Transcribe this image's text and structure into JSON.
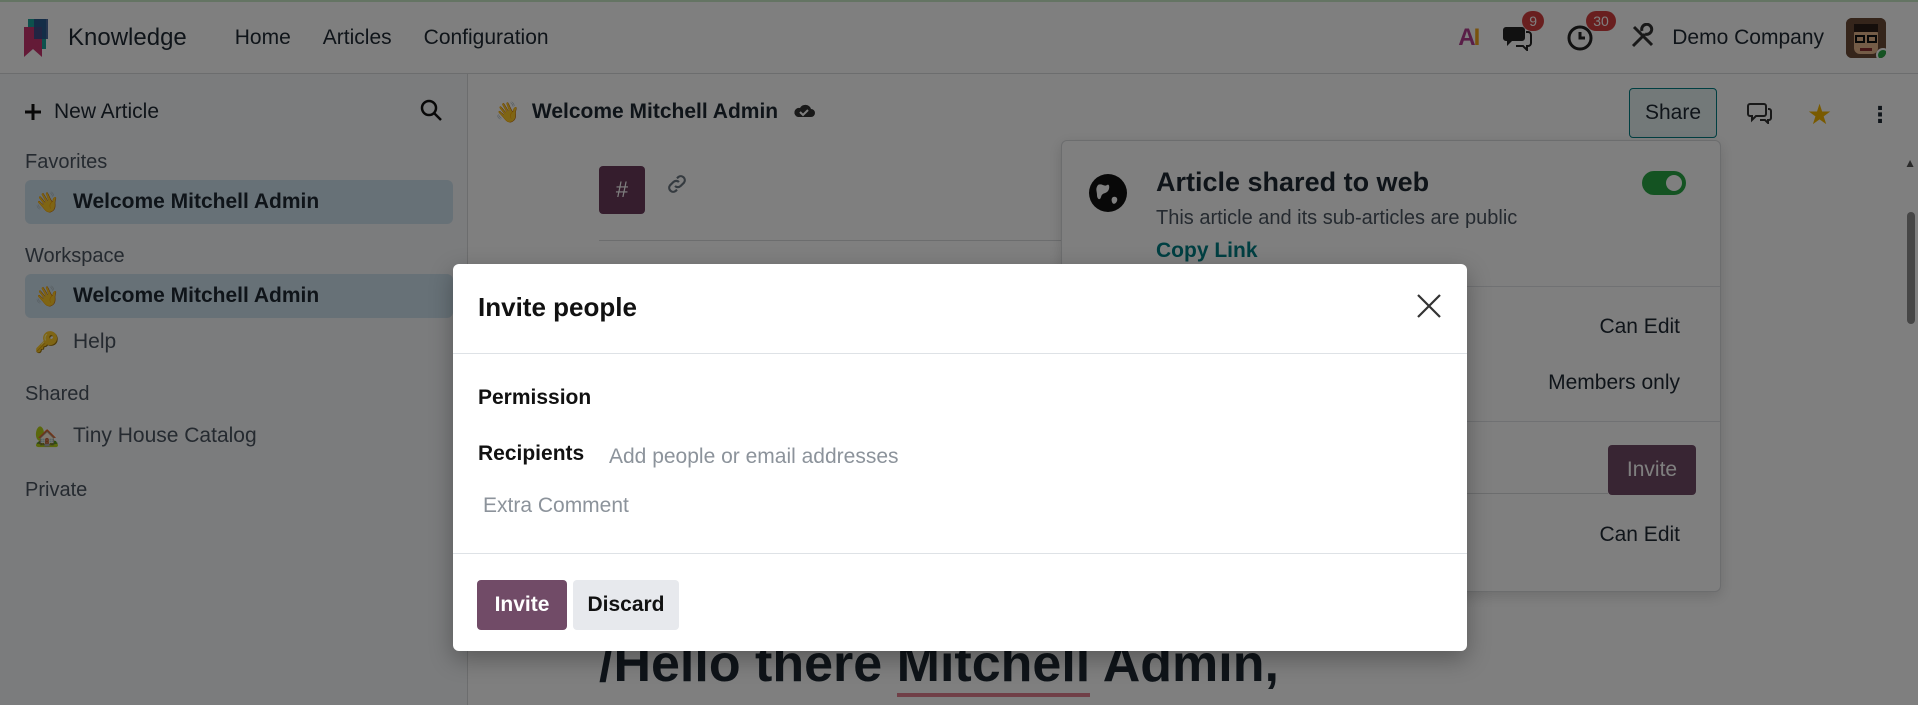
{
  "navbar": {
    "app_name": "Knowledge",
    "menu": [
      "Home",
      "Articles",
      "Configuration"
    ],
    "ai_icon_text": {
      "a": "A",
      "i": "I"
    },
    "messages_count": "9",
    "activities_count": "30",
    "company": "Demo Company",
    "icons": {
      "app_logo": "knowledge-logo-icon",
      "messages": "chat-bubbles-icon",
      "activities": "clock-icon",
      "debug": "tools-icon"
    }
  },
  "sidebar": {
    "new_article_label": "New Article",
    "sections": {
      "favorites": "Favorites",
      "workspace": "Workspace",
      "shared": "Shared",
      "private": "Private"
    },
    "favorites_items": [
      {
        "emoji": "👋",
        "label": "Welcome Mitchell Admin"
      }
    ],
    "workspace_items": [
      {
        "emoji": "👋",
        "label": "Welcome Mitchell Admin"
      },
      {
        "emoji": "🔑",
        "label": "Help"
      }
    ],
    "shared_items": [
      {
        "emoji": "🏡",
        "label": "Tiny House Catalog"
      }
    ]
  },
  "main": {
    "breadcrumb_emoji": "👋",
    "breadcrumb_title": "Welcome Mitchell Admin",
    "share_label": "Share",
    "editor": {
      "hash_label": "#",
      "hello_prefix": "/Hello there ",
      "hello_underlined": "Mitchell",
      "hello_suffix": " Admin,"
    }
  },
  "share_panel": {
    "title": "Article shared to web",
    "subtitle": "This article and its sub-articles are public",
    "copy_link": "Copy Link",
    "published": true,
    "row1_value": "Can Edit",
    "row2_value": "Members only",
    "invite_label": "Invite",
    "row3_value": "Can Edit"
  },
  "modal": {
    "title": "Invite people",
    "permission_label": "Permission",
    "recipients_label": "Recipients",
    "recipients_placeholder": "Add people or email addresses",
    "comment_placeholder": "Extra Comment",
    "invite_button": "Invite",
    "discard_button": "Discard"
  },
  "colors": {
    "brand_purple": "#714b67",
    "teal": "#017e84",
    "badge_red": "#d23f3f",
    "star_yellow": "#f3b500",
    "toggle_green": "#28a745"
  }
}
